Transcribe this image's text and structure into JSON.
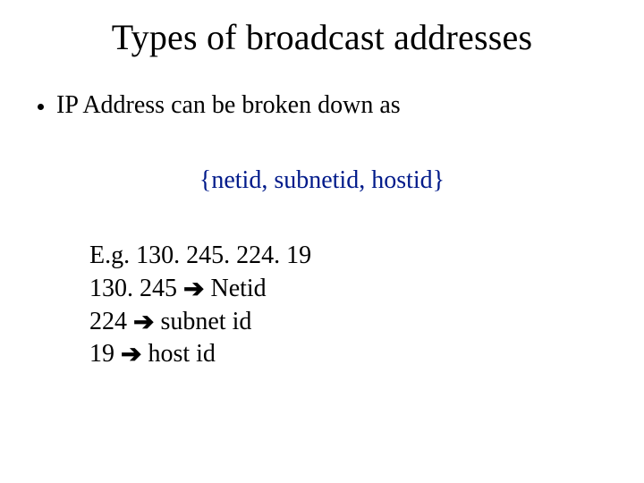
{
  "title": "Types of broadcast addresses",
  "bullet1": "IP Address can be broken down as",
  "formula": "{netid, subnetid, hostid}",
  "example": {
    "line1": "E.g. 130. 245. 224. 19",
    "l2a": "130. 245 ",
    "l2b": " Netid",
    "l3a": "224 ",
    "l3b": " subnet id",
    "l4a": "19 ",
    "l4b": " host id"
  },
  "arrow": "➔"
}
